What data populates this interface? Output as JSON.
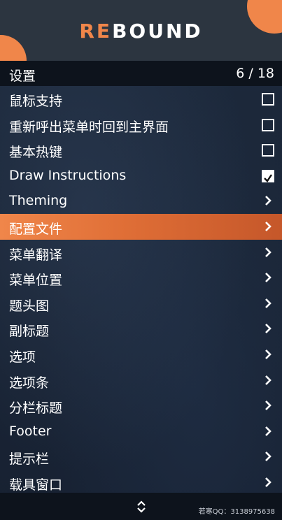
{
  "brand": {
    "logo_accent": "RE",
    "logo_rest": "BOUND",
    "accent_color": "#f0864a"
  },
  "subheader": {
    "title": "设置",
    "counter": "6 / 18"
  },
  "menu": {
    "items": [
      {
        "label": "鼠标支持",
        "control": "checkbox",
        "checked": false
      },
      {
        "label": "重新呼出菜单时回到主界面",
        "control": "checkbox",
        "checked": false
      },
      {
        "label": "基本热键",
        "control": "checkbox",
        "checked": false
      },
      {
        "label": "Draw Instructions",
        "control": "checkbox",
        "checked": true
      },
      {
        "label": "Theming",
        "control": "submenu"
      },
      {
        "label": "配置文件",
        "control": "submenu",
        "selected": true
      },
      {
        "label": "菜单翻译",
        "control": "submenu"
      },
      {
        "label": "菜单位置",
        "control": "submenu"
      },
      {
        "label": "题头图",
        "control": "submenu"
      },
      {
        "label": "副标题",
        "control": "submenu"
      },
      {
        "label": "选项",
        "control": "submenu"
      },
      {
        "label": "选项条",
        "control": "submenu"
      },
      {
        "label": "分栏标题",
        "control": "submenu"
      },
      {
        "label": "Footer",
        "control": "submenu"
      },
      {
        "label": "提示栏",
        "control": "submenu"
      },
      {
        "label": "载具窗口",
        "control": "submenu"
      }
    ]
  },
  "footer": {
    "credit": "若寒QQ：3138975638",
    "scroll_icon": "up-down-arrows-icon"
  }
}
